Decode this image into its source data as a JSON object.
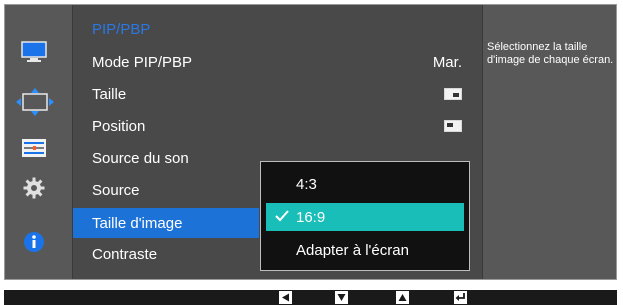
{
  "menu": {
    "header": "PIP/PBP",
    "items": [
      {
        "label": "Mode PIP/PBP",
        "value": "Mar."
      },
      {
        "label": "Taille",
        "value_icon": "pip-size-icon"
      },
      {
        "label": "Position",
        "value_icon": "pip-position-icon"
      },
      {
        "label": "Source du son"
      },
      {
        "label": "Source"
      },
      {
        "label": "Taille d'image",
        "active": true
      },
      {
        "label": "Contraste"
      }
    ]
  },
  "popup": {
    "options": [
      {
        "label": "4:3",
        "selected": false
      },
      {
        "label": "16:9",
        "selected": true
      },
      {
        "label": "Adapter à l'écran",
        "selected": false
      }
    ]
  },
  "help": {
    "text": "Sélectionnez la taille d'image de chaque écran."
  },
  "sidebar_icons": [
    {
      "name": "picture-icon",
      "active": false
    },
    {
      "name": "onscreen-display-move-icon",
      "active": true
    },
    {
      "name": "system-sliders-icon",
      "active": false
    },
    {
      "name": "gear-icon",
      "active": false
    },
    {
      "name": "info-icon",
      "active": false
    }
  ],
  "nav_keys": [
    "arrow-left-key-icon",
    "arrow-down-key-icon",
    "arrow-up-key-icon",
    "enter-key-icon"
  ],
  "colors": {
    "panel": "#494949",
    "frame": "#585858",
    "accent_blue": "#1c72d6",
    "selected_teal": "#1abeb8"
  }
}
